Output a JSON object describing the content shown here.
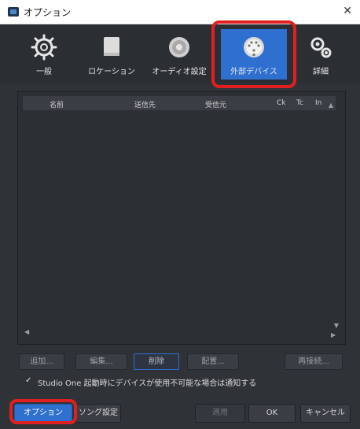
{
  "window": {
    "title": "オプション"
  },
  "toolbar": {
    "items": [
      {
        "label": "一般"
      },
      {
        "label": "ロケーション"
      },
      {
        "label": "オーディオ設定"
      },
      {
        "label": "外部デバイス"
      },
      {
        "label": "詳細"
      }
    ]
  },
  "table": {
    "columns": [
      "名前",
      "送信先",
      "受信元",
      "Ck",
      "Tc",
      "In"
    ]
  },
  "actions": {
    "add": "追加...",
    "edit": "編集...",
    "delete": "削除",
    "placement": "配置...",
    "reconnect": "再接続..."
  },
  "notify": {
    "checked": true,
    "label": "Studio One 起動時にデバイスが使用不可能な場合は通知する"
  },
  "bottom": {
    "options": "オプション",
    "song_settings": "ソング設定",
    "apply": "適用",
    "ok": "OK",
    "cancel": "キャンセル"
  },
  "colors": {
    "accent": "#2e6fd0",
    "highlight": "#e02020"
  }
}
